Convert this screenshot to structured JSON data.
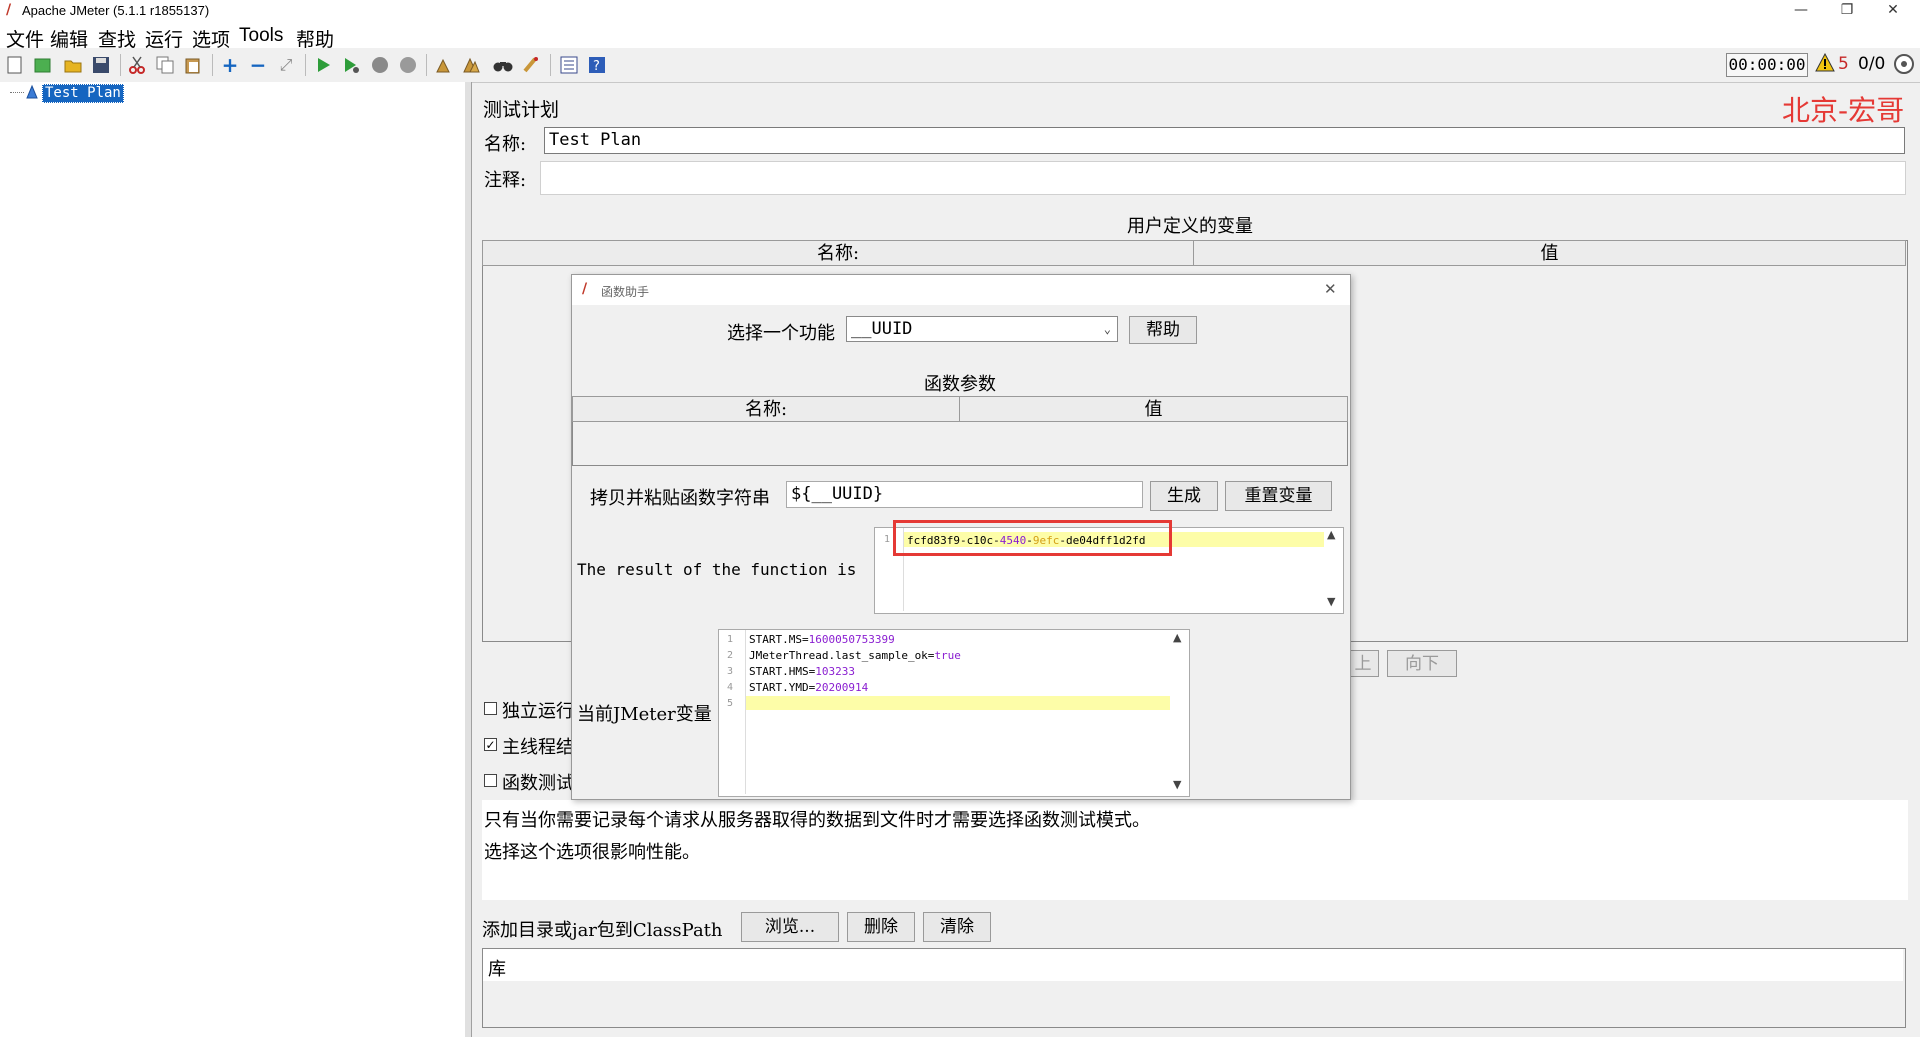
{
  "window": {
    "title": "Apache JMeter (5.1.1 r1855137)",
    "minimize": "—",
    "restore": "❐",
    "close": "✕"
  },
  "menu": [
    "文件",
    "编辑",
    "查找",
    "运行",
    "选项",
    "Tools",
    "帮助"
  ],
  "toolbar": {
    "timer": "00:00:00",
    "warning_count": "5",
    "thread_ratio": "0/0"
  },
  "tree": {
    "selected_item": "Test Plan"
  },
  "test_plan": {
    "heading": "测试计划",
    "watermark": "北京-宏哥",
    "name_label": "名称:",
    "name_value": "Test Plan",
    "comment_label": "注释:",
    "comment_value": "",
    "variables_title": "用户定义的变量",
    "var_col_name": "名称:",
    "var_col_value": "值",
    "btn_up": "上",
    "btn_down": "向下",
    "check_standalone": "独立运行",
    "check_main_thread": "主线程结",
    "check_function_test": "函数测试",
    "info_line1": "只有当你需要记录每个请求从服务器取得的数据到文件时才需要选择函数测试模式。",
    "info_line2": "选择这个选项很影响性能。",
    "classpath_label": "添加目录或jar包到ClassPath",
    "btn_browse": "浏览...",
    "btn_delete": "删除",
    "btn_clear": "清除",
    "lib_header": "库"
  },
  "dialog": {
    "title": "函数助手",
    "close": "✕",
    "select_label": "选择一个功能",
    "select_value": "__UUID",
    "help_button": "帮助",
    "params_title": "函数参数",
    "params_col_name": "名称:",
    "params_col_value": "值",
    "copy_label": "拷贝并粘贴函数字符串",
    "copy_value": "${__UUID}",
    "generate_button": "生成",
    "reset_button": "重置变量",
    "result_label": "The result of the function is",
    "result_line_no": "1",
    "result_uuid": {
      "p1": "fcfd83f9-c10c-",
      "p2": "4540",
      "p3": "-",
      "p4": "9efc",
      "p5": "-de04dff1d2fd"
    },
    "vars_label": "当前JMeter变量",
    "vars": [
      {
        "no": "1",
        "key": "START.MS=",
        "val": "1600050753399"
      },
      {
        "no": "2",
        "key": "JMeterThread.last_sample_ok=",
        "val": "true"
      },
      {
        "no": "3",
        "key": "START.HMS=",
        "val": "103233"
      },
      {
        "no": "4",
        "key": "START.YMD=",
        "val": "20200914"
      },
      {
        "no": "5",
        "key": "",
        "val": ""
      }
    ]
  }
}
